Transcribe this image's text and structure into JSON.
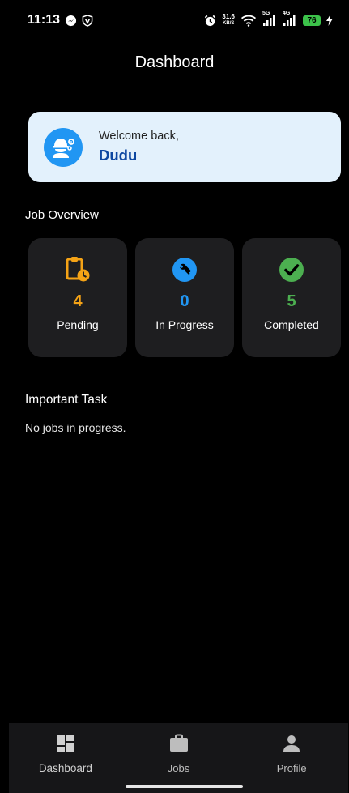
{
  "status_bar": {
    "time": "11:13",
    "net_speed_value": "31.6",
    "net_speed_unit": "KB/S",
    "sim1_label": "5G",
    "sim2_label": "4G",
    "battery": "76",
    "icons": [
      "messenger-icon",
      "vpn-shield-icon",
      "alarm-icon",
      "wifi-icon",
      "signal-icon",
      "charging-bolt-icon"
    ]
  },
  "header": {
    "title": "Dashboard"
  },
  "welcome": {
    "greeting": "Welcome back,",
    "user_name": "Dudu",
    "avatar_icon": "engineer-worker-icon"
  },
  "job_overview": {
    "title": "Job Overview",
    "cards": [
      {
        "label": "Pending",
        "count": "4",
        "icon": "clipboard-clock-icon",
        "color": "#f5a316"
      },
      {
        "label": "In Progress",
        "count": "0",
        "icon": "wrench-circle-icon",
        "color": "#2196f3"
      },
      {
        "label": "Completed",
        "count": "5",
        "icon": "check-circle-icon",
        "color": "#4caf50"
      }
    ]
  },
  "important_task": {
    "title": "Important Task",
    "empty_message": "No jobs in progress."
  },
  "bottom_nav": {
    "items": [
      {
        "label": "Dashboard",
        "icon": "dashboard-icon"
      },
      {
        "label": "Jobs",
        "icon": "briefcase-icon"
      },
      {
        "label": "Profile",
        "icon": "person-icon"
      }
    ],
    "active": "Dashboard"
  },
  "colors": {
    "background": "#000000",
    "card_background": "#1e1e20",
    "welcome_card": "#e3f1fc",
    "accent_blue": "#2196f3",
    "name_blue": "#0d47a1"
  }
}
